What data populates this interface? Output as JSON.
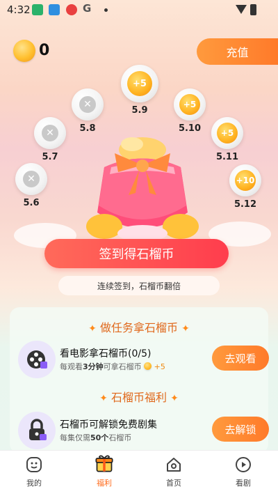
{
  "status_bar": {
    "time": "4:32"
  },
  "header": {
    "balance": "0",
    "recharge_label": "充值"
  },
  "checkin": {
    "days": [
      {
        "date": "5.6",
        "state": "missed"
      },
      {
        "date": "5.7",
        "state": "missed"
      },
      {
        "date": "5.8",
        "state": "missed"
      },
      {
        "date": "5.9",
        "state": "reward",
        "reward": "+5"
      },
      {
        "date": "5.10",
        "state": "reward",
        "reward": "+5"
      },
      {
        "date": "5.11",
        "state": "reward",
        "reward": "+5"
      },
      {
        "date": "5.12",
        "state": "reward",
        "reward": "+10"
      }
    ],
    "button_label": "签到得石榴币",
    "tip": "连续签到，石榴币翻倍"
  },
  "tasks_section": {
    "title": "做任务拿石榴币",
    "items": [
      {
        "title": "看电影拿石榴币(0/5)",
        "desc_prefix": "每观看",
        "desc_highlight": "3分钟",
        "desc_suffix": "可拿石榴币",
        "reward": "+5",
        "button": "去观看"
      }
    ]
  },
  "benefits_section": {
    "title": "石榴币福利",
    "items": [
      {
        "title": "石榴币可解锁免费剧集",
        "desc_prefix": "每集仅需",
        "desc_highlight": "50个",
        "desc_suffix": "石榴币",
        "button": "去解锁"
      }
    ]
  },
  "tabbar": {
    "items": [
      {
        "label": "我的",
        "icon": "smiley-icon"
      },
      {
        "label": "福利",
        "icon": "gift-icon",
        "active": true
      },
      {
        "label": "首页",
        "icon": "home-icon"
      },
      {
        "label": "看剧",
        "icon": "play-icon"
      }
    ]
  },
  "colors": {
    "accent": "#ff7a2a",
    "primary_button": "#ff4a4f",
    "coin": "#ffb21f"
  }
}
